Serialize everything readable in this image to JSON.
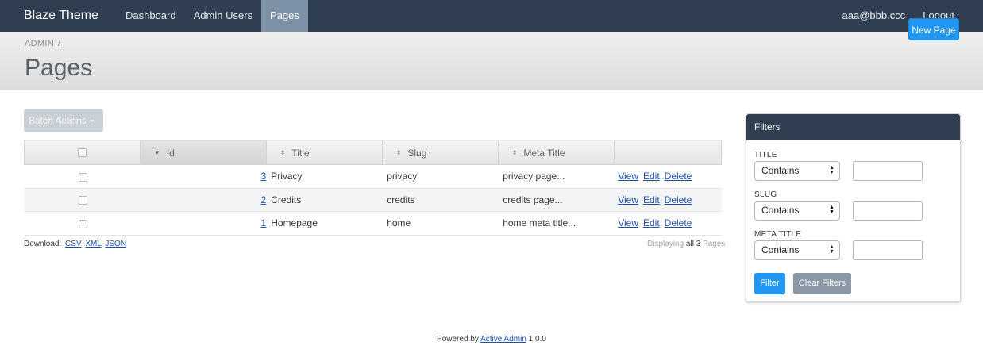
{
  "header": {
    "brand": "Blaze Theme",
    "nav": [
      {
        "label": "Dashboard",
        "active": false
      },
      {
        "label": "Admin Users",
        "active": false
      },
      {
        "label": "Pages",
        "active": true
      }
    ],
    "utility": [
      {
        "label": "aaa@bbb.ccc"
      },
      {
        "label": "Logout"
      }
    ]
  },
  "titlebar": {
    "breadcrumb": "ADMIN",
    "breadcrumb_sep": "/",
    "title": "Pages",
    "new_button": "New Page"
  },
  "batch_actions": "Batch Actions",
  "table": {
    "columns": [
      "",
      "Id",
      "Title",
      "Slug",
      "Meta Title",
      ""
    ],
    "rows": [
      {
        "id": "3",
        "title": "Privacy",
        "slug": "privacy",
        "meta_title": "privacy page..."
      },
      {
        "id": "2",
        "title": "Credits",
        "slug": "credits",
        "meta_title": "credits page..."
      },
      {
        "id": "1",
        "title": "Homepage",
        "slug": "home",
        "meta_title": "home meta title..."
      }
    ],
    "actions": [
      "View",
      "Edit",
      "Delete"
    ]
  },
  "download": {
    "label": "Download:",
    "formats": [
      "CSV",
      "XML",
      "JSON"
    ]
  },
  "pagination": {
    "prefix": "Displaying",
    "all": "all 3",
    "suffix": "Pages"
  },
  "filters": {
    "title": "Filters",
    "fields": [
      {
        "label": "TITLE",
        "operator": "Contains",
        "value": ""
      },
      {
        "label": "SLUG",
        "operator": "Contains",
        "value": ""
      },
      {
        "label": "META TITLE",
        "operator": "Contains",
        "value": ""
      }
    ],
    "filter_button": "Filter",
    "clear_button": "Clear Filters"
  },
  "footer": {
    "prefix": "Powered by",
    "link": "Active Admin",
    "version": "1.0.0"
  },
  "colors": {
    "nav_bg": "#2f3e51",
    "nav_active": "#7d91a5",
    "primary": "#2196f3",
    "link": "#1e4fa8"
  }
}
